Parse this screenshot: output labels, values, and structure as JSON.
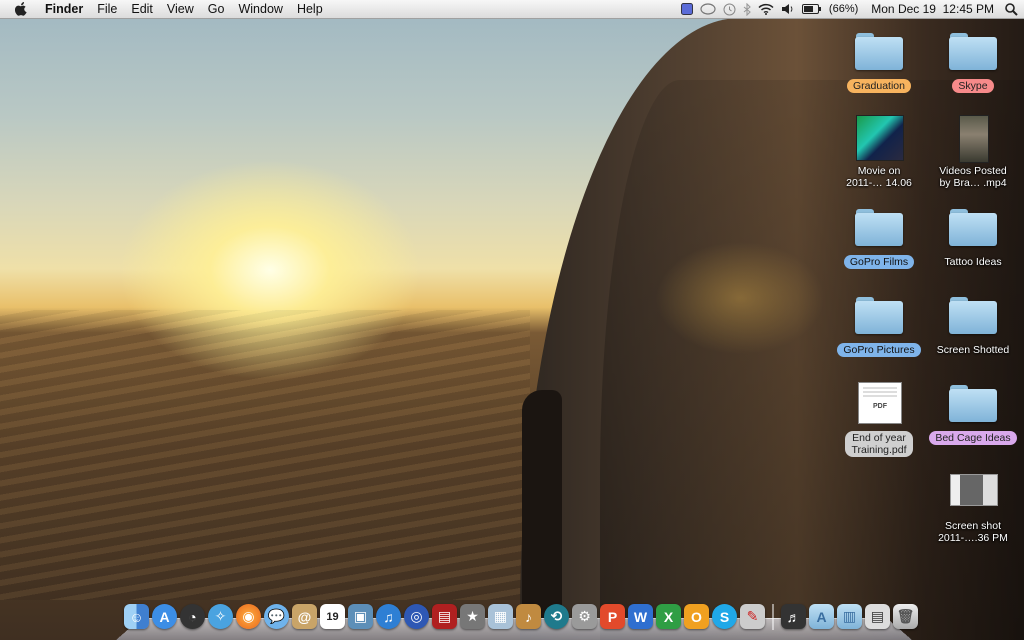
{
  "menubar": {
    "app_name": "Finder",
    "menus": [
      "File",
      "Edit",
      "View",
      "Go",
      "Window",
      "Help"
    ],
    "battery": "(66%)",
    "datetime": "Mon Dec 19  12:45 PM"
  },
  "desktop_icons": [
    {
      "id": "graduation",
      "type": "folder",
      "label": "Graduation",
      "label_color": "orange"
    },
    {
      "id": "skype",
      "type": "folder",
      "label": "Skype",
      "label_color": "red"
    },
    {
      "id": "movie",
      "type": "video",
      "label_line1": "Movie on",
      "label_line2": "2011-… 14.06"
    },
    {
      "id": "videos-posted",
      "type": "video",
      "label_line1": "Videos Posted",
      "label_line2": "by Bra… .mp4"
    },
    {
      "id": "gopro-films",
      "type": "folder",
      "label": "GoPro Films",
      "label_color": "blue"
    },
    {
      "id": "tattoo-ideas",
      "type": "folder",
      "label": "Tattoo Ideas"
    },
    {
      "id": "gopro-pictures",
      "type": "folder",
      "label": "GoPro Pictures",
      "label_color": "blue"
    },
    {
      "id": "screen-shotted",
      "type": "folder",
      "label": "Screen Shotted"
    },
    {
      "id": "end-of-year",
      "type": "pdf",
      "label_line1": "End of year",
      "label_line2": "Training.pdf",
      "label_color": "gray",
      "badge": "PDF"
    },
    {
      "id": "bed-cage-ideas",
      "type": "folder",
      "label": "Bed Cage Ideas",
      "label_color": "purple"
    },
    {
      "id": "screen-shot",
      "type": "image",
      "label_line1": "Screen shot",
      "label_line2": "2011-….36 PM"
    }
  ],
  "dock": {
    "calendar_day": "19",
    "colors": {
      "finder": "#4a8fdc",
      "appstore": "#3c8ee6",
      "firefox": "#e8651c",
      "word": "#2f6fd0",
      "excel": "#2f9e44",
      "outlook": "#f0a020",
      "skype": "#20a8e8",
      "ppt": "#e24a2b"
    },
    "letters": {
      "word": "W",
      "excel": "X",
      "outlook": "O",
      "skype": "S"
    }
  }
}
